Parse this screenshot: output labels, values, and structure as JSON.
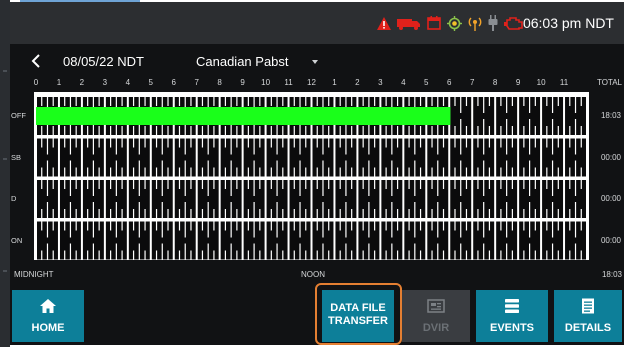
{
  "status_bar": {
    "time": "06:03 pm NDT",
    "icons": [
      "warning-icon",
      "truck-icon",
      "calendar-icon",
      "gps-icon",
      "signal-icon",
      "plug-icon",
      "engine-icon"
    ],
    "alert_color": "#e0211b",
    "ok_color": "#8bc34a",
    "amber_color": "#f2a32a"
  },
  "header": {
    "date": "08/05/22 NDT",
    "driver": "Canadian Pabst"
  },
  "grid": {
    "hour_labels": [
      "0",
      "1",
      "2",
      "3",
      "4",
      "5",
      "6",
      "7",
      "8",
      "9",
      "10",
      "11",
      "12",
      "1",
      "2",
      "3",
      "4",
      "5",
      "6",
      "7",
      "8",
      "9",
      "10",
      "11"
    ],
    "total_label": "TOTAL",
    "rows": [
      {
        "status": "OFF",
        "total": "18:03"
      },
      {
        "status": "SB",
        "total": "00:00"
      },
      {
        "status": "D",
        "total": "00:00"
      },
      {
        "status": "ON",
        "total": "00:00"
      }
    ],
    "duty_segments": [
      {
        "status": "OFF",
        "start_hour": 0,
        "end_hour": 18.05
      }
    ],
    "duty_color": "#1aff1a",
    "midnight_label": "MIDNIGHT",
    "noon_label": "NOON",
    "grand_total": "18:03"
  },
  "bottom_nav": {
    "home": "HOME",
    "data_file_transfer_line1": "DATA FILE",
    "data_file_transfer_line2": "TRANSFER",
    "dvir": "DVIR",
    "events": "EVENTS",
    "details": "DETAILS",
    "accent_color": "#0d7f99",
    "highlight_color": "#e47f32"
  }
}
